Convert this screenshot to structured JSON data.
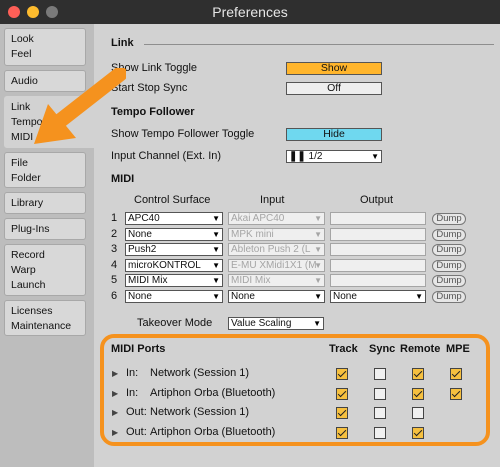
{
  "window": {
    "title": "Preferences"
  },
  "sidebar": {
    "items": [
      {
        "lines": [
          "Look",
          "Feel"
        ]
      },
      {
        "lines": [
          "Audio"
        ]
      },
      {
        "lines": [
          "Link",
          "Tempo",
          "MIDI"
        ]
      },
      {
        "lines": [
          "File",
          "Folder"
        ]
      },
      {
        "lines": [
          "Library"
        ]
      },
      {
        "lines": [
          "Plug-Ins"
        ]
      },
      {
        "lines": [
          "Record",
          "Warp",
          "Launch"
        ]
      },
      {
        "lines": [
          "Licenses",
          "Maintenance"
        ]
      }
    ]
  },
  "link": {
    "section": "Link",
    "show_link_toggle_label": "Show Link Toggle",
    "show_link_toggle_value": "Show",
    "start_stop_sync_label": "Start Stop Sync",
    "start_stop_sync_value": "Off"
  },
  "tempo": {
    "section": "Tempo Follower",
    "show_toggle_label": "Show Tempo Follower Toggle",
    "show_toggle_value": "Hide",
    "input_channel_label": "Input Channel (Ext. In)",
    "input_channel_value": "1/2"
  },
  "midi": {
    "section": "MIDI",
    "headers": {
      "control_surface": "Control Surface",
      "input": "Input",
      "output": "Output"
    },
    "dump_label": "Dump",
    "rows": [
      {
        "num": "1",
        "surface": "APC40",
        "input": "Akai APC40",
        "output": "",
        "input_disabled": true,
        "output_disabled": true
      },
      {
        "num": "2",
        "surface": "None",
        "input": "MPK mini",
        "output": "",
        "input_disabled": true,
        "output_disabled": true
      },
      {
        "num": "3",
        "surface": "Push2",
        "input": "Ableton Push 2 (L",
        "output": "",
        "input_disabled": true,
        "output_disabled": true
      },
      {
        "num": "4",
        "surface": "microKONTROL",
        "input": "E-MU XMidi1X1 (M",
        "output": "",
        "input_disabled": true,
        "output_disabled": true
      },
      {
        "num": "5",
        "surface": "MIDI Mix",
        "input": "MIDI Mix",
        "output": "",
        "input_disabled": true,
        "output_disabled": true
      },
      {
        "num": "6",
        "surface": "None",
        "input": "None",
        "output": "None",
        "input_disabled": false,
        "output_disabled": false
      }
    ],
    "takeover_label": "Takeover Mode",
    "takeover_value": "Value Scaling"
  },
  "ports": {
    "title": "MIDI Ports",
    "columns": [
      "Track",
      "Sync",
      "Remote",
      "MPE"
    ],
    "rows": [
      {
        "dir": "In:",
        "name": "Network (Session 1)",
        "track": true,
        "sync": false,
        "remote": true,
        "mpe": true,
        "show_mpe": true
      },
      {
        "dir": "In:",
        "name": "Artiphon Orba (Bluetooth)",
        "track": true,
        "sync": false,
        "remote": true,
        "mpe": true,
        "show_mpe": true
      },
      {
        "dir": "Out:",
        "name": "Network (Session 1)",
        "track": true,
        "sync": false,
        "remote": false,
        "mpe": false,
        "show_mpe": false
      },
      {
        "dir": "Out:",
        "name": "Artiphon Orba (Bluetooth)",
        "track": true,
        "sync": false,
        "remote": true,
        "mpe": false,
        "show_mpe": false
      }
    ]
  },
  "colors": {
    "accent_orange": "#f5921e",
    "toggle_on": "#ffb52c",
    "toggle_blue": "#6fd8ef",
    "checkbox_on": "#f6c03f"
  }
}
